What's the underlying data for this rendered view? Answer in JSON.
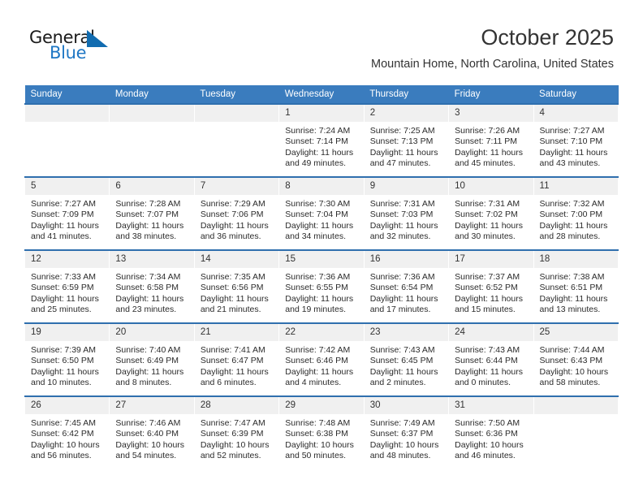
{
  "brand": {
    "name_top": "General",
    "name_bottom": "Blue",
    "accent_color": "#116cb0"
  },
  "header": {
    "month_title": "October 2025",
    "location": "Mountain Home, North Carolina, United States"
  },
  "theme": {
    "header_row_bg": "#3a7cbe",
    "row_divider": "#2f6fae",
    "daynum_bg": "#f0f0f0"
  },
  "weekdays": [
    "Sunday",
    "Monday",
    "Tuesday",
    "Wednesday",
    "Thursday",
    "Friday",
    "Saturday"
  ],
  "weeks": [
    [
      {
        "day": "",
        "empty": true
      },
      {
        "day": "",
        "empty": true
      },
      {
        "day": "",
        "empty": true
      },
      {
        "day": "1",
        "sunrise": "Sunrise: 7:24 AM",
        "sunset": "Sunset: 7:14 PM",
        "daylight1": "Daylight: 11 hours",
        "daylight2": "and 49 minutes."
      },
      {
        "day": "2",
        "sunrise": "Sunrise: 7:25 AM",
        "sunset": "Sunset: 7:13 PM",
        "daylight1": "Daylight: 11 hours",
        "daylight2": "and 47 minutes."
      },
      {
        "day": "3",
        "sunrise": "Sunrise: 7:26 AM",
        "sunset": "Sunset: 7:11 PM",
        "daylight1": "Daylight: 11 hours",
        "daylight2": "and 45 minutes."
      },
      {
        "day": "4",
        "sunrise": "Sunrise: 7:27 AM",
        "sunset": "Sunset: 7:10 PM",
        "daylight1": "Daylight: 11 hours",
        "daylight2": "and 43 minutes."
      }
    ],
    [
      {
        "day": "5",
        "sunrise": "Sunrise: 7:27 AM",
        "sunset": "Sunset: 7:09 PM",
        "daylight1": "Daylight: 11 hours",
        "daylight2": "and 41 minutes."
      },
      {
        "day": "6",
        "sunrise": "Sunrise: 7:28 AM",
        "sunset": "Sunset: 7:07 PM",
        "daylight1": "Daylight: 11 hours",
        "daylight2": "and 38 minutes."
      },
      {
        "day": "7",
        "sunrise": "Sunrise: 7:29 AM",
        "sunset": "Sunset: 7:06 PM",
        "daylight1": "Daylight: 11 hours",
        "daylight2": "and 36 minutes."
      },
      {
        "day": "8",
        "sunrise": "Sunrise: 7:30 AM",
        "sunset": "Sunset: 7:04 PM",
        "daylight1": "Daylight: 11 hours",
        "daylight2": "and 34 minutes."
      },
      {
        "day": "9",
        "sunrise": "Sunrise: 7:31 AM",
        "sunset": "Sunset: 7:03 PM",
        "daylight1": "Daylight: 11 hours",
        "daylight2": "and 32 minutes."
      },
      {
        "day": "10",
        "sunrise": "Sunrise: 7:31 AM",
        "sunset": "Sunset: 7:02 PM",
        "daylight1": "Daylight: 11 hours",
        "daylight2": "and 30 minutes."
      },
      {
        "day": "11",
        "sunrise": "Sunrise: 7:32 AM",
        "sunset": "Sunset: 7:00 PM",
        "daylight1": "Daylight: 11 hours",
        "daylight2": "and 28 minutes."
      }
    ],
    [
      {
        "day": "12",
        "sunrise": "Sunrise: 7:33 AM",
        "sunset": "Sunset: 6:59 PM",
        "daylight1": "Daylight: 11 hours",
        "daylight2": "and 25 minutes."
      },
      {
        "day": "13",
        "sunrise": "Sunrise: 7:34 AM",
        "sunset": "Sunset: 6:58 PM",
        "daylight1": "Daylight: 11 hours",
        "daylight2": "and 23 minutes."
      },
      {
        "day": "14",
        "sunrise": "Sunrise: 7:35 AM",
        "sunset": "Sunset: 6:56 PM",
        "daylight1": "Daylight: 11 hours",
        "daylight2": "and 21 minutes."
      },
      {
        "day": "15",
        "sunrise": "Sunrise: 7:36 AM",
        "sunset": "Sunset: 6:55 PM",
        "daylight1": "Daylight: 11 hours",
        "daylight2": "and 19 minutes."
      },
      {
        "day": "16",
        "sunrise": "Sunrise: 7:36 AM",
        "sunset": "Sunset: 6:54 PM",
        "daylight1": "Daylight: 11 hours",
        "daylight2": "and 17 minutes."
      },
      {
        "day": "17",
        "sunrise": "Sunrise: 7:37 AM",
        "sunset": "Sunset: 6:52 PM",
        "daylight1": "Daylight: 11 hours",
        "daylight2": "and 15 minutes."
      },
      {
        "day": "18",
        "sunrise": "Sunrise: 7:38 AM",
        "sunset": "Sunset: 6:51 PM",
        "daylight1": "Daylight: 11 hours",
        "daylight2": "and 13 minutes."
      }
    ],
    [
      {
        "day": "19",
        "sunrise": "Sunrise: 7:39 AM",
        "sunset": "Sunset: 6:50 PM",
        "daylight1": "Daylight: 11 hours",
        "daylight2": "and 10 minutes."
      },
      {
        "day": "20",
        "sunrise": "Sunrise: 7:40 AM",
        "sunset": "Sunset: 6:49 PM",
        "daylight1": "Daylight: 11 hours",
        "daylight2": "and 8 minutes."
      },
      {
        "day": "21",
        "sunrise": "Sunrise: 7:41 AM",
        "sunset": "Sunset: 6:47 PM",
        "daylight1": "Daylight: 11 hours",
        "daylight2": "and 6 minutes."
      },
      {
        "day": "22",
        "sunrise": "Sunrise: 7:42 AM",
        "sunset": "Sunset: 6:46 PM",
        "daylight1": "Daylight: 11 hours",
        "daylight2": "and 4 minutes."
      },
      {
        "day": "23",
        "sunrise": "Sunrise: 7:43 AM",
        "sunset": "Sunset: 6:45 PM",
        "daylight1": "Daylight: 11 hours",
        "daylight2": "and 2 minutes."
      },
      {
        "day": "24",
        "sunrise": "Sunrise: 7:43 AM",
        "sunset": "Sunset: 6:44 PM",
        "daylight1": "Daylight: 11 hours",
        "daylight2": "and 0 minutes."
      },
      {
        "day": "25",
        "sunrise": "Sunrise: 7:44 AM",
        "sunset": "Sunset: 6:43 PM",
        "daylight1": "Daylight: 10 hours",
        "daylight2": "and 58 minutes."
      }
    ],
    [
      {
        "day": "26",
        "sunrise": "Sunrise: 7:45 AM",
        "sunset": "Sunset: 6:42 PM",
        "daylight1": "Daylight: 10 hours",
        "daylight2": "and 56 minutes."
      },
      {
        "day": "27",
        "sunrise": "Sunrise: 7:46 AM",
        "sunset": "Sunset: 6:40 PM",
        "daylight1": "Daylight: 10 hours",
        "daylight2": "and 54 minutes."
      },
      {
        "day": "28",
        "sunrise": "Sunrise: 7:47 AM",
        "sunset": "Sunset: 6:39 PM",
        "daylight1": "Daylight: 10 hours",
        "daylight2": "and 52 minutes."
      },
      {
        "day": "29",
        "sunrise": "Sunrise: 7:48 AM",
        "sunset": "Sunset: 6:38 PM",
        "daylight1": "Daylight: 10 hours",
        "daylight2": "and 50 minutes."
      },
      {
        "day": "30",
        "sunrise": "Sunrise: 7:49 AM",
        "sunset": "Sunset: 6:37 PM",
        "daylight1": "Daylight: 10 hours",
        "daylight2": "and 48 minutes."
      },
      {
        "day": "31",
        "sunrise": "Sunrise: 7:50 AM",
        "sunset": "Sunset: 6:36 PM",
        "daylight1": "Daylight: 10 hours",
        "daylight2": "and 46 minutes."
      },
      {
        "day": "",
        "empty": true
      }
    ]
  ]
}
